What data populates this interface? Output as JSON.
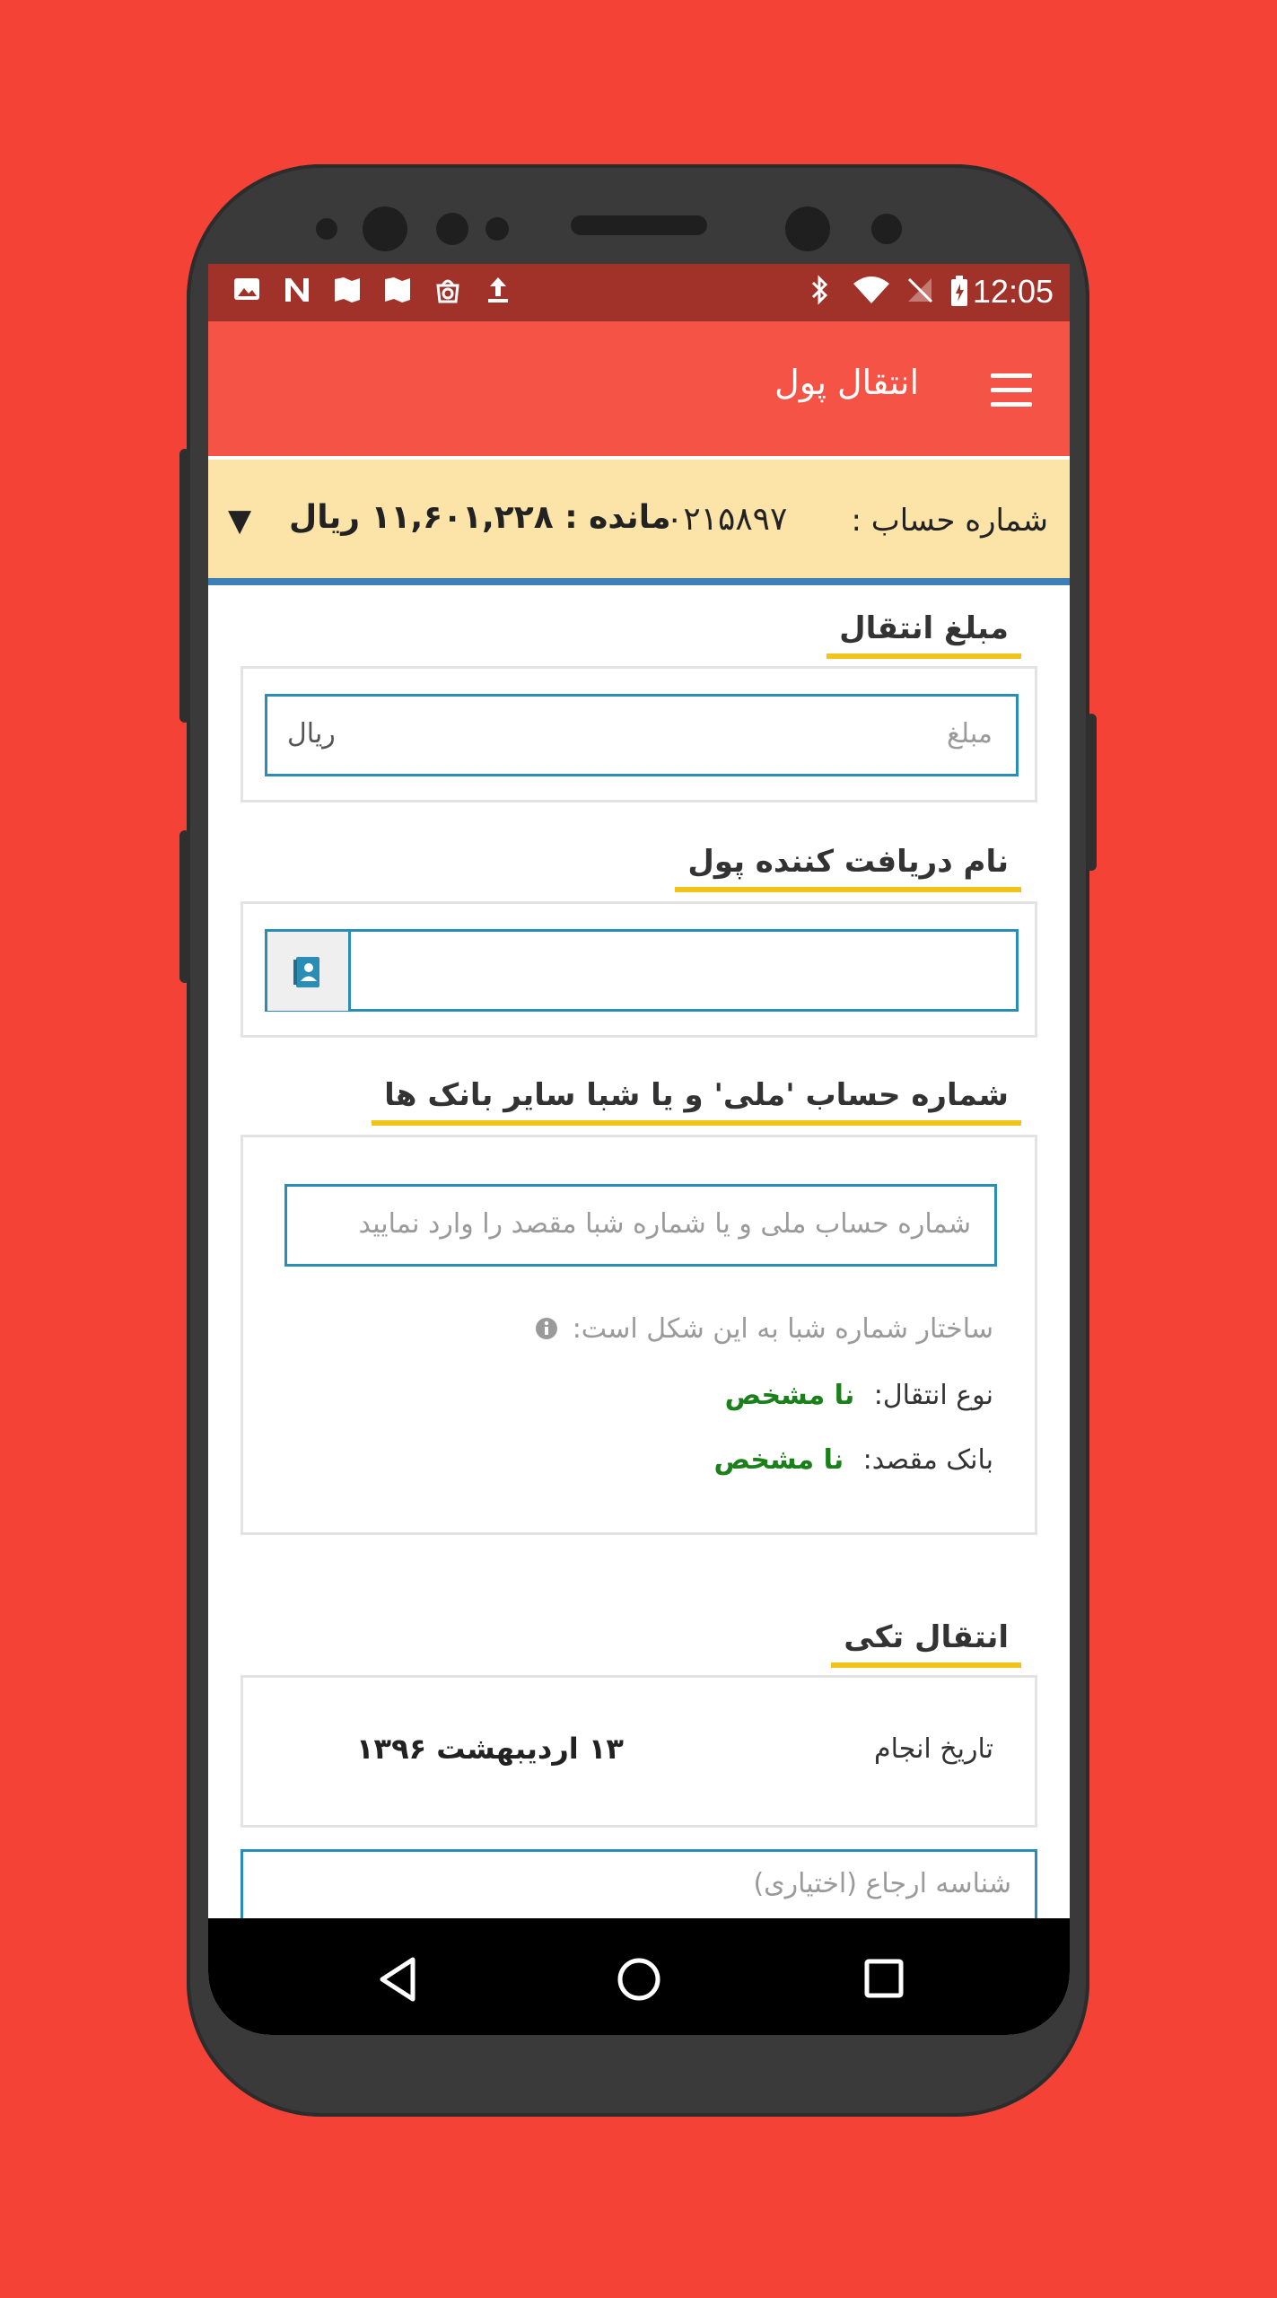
{
  "status_bar": {
    "time": "12:05",
    "left_icons": [
      "image-icon",
      "n-icon",
      "map-icon",
      "map-icon",
      "sync-icon",
      "upload-icon"
    ],
    "right_icons": [
      "bluetooth-icon",
      "wifi-icon",
      "no-signal-icon",
      "battery-icon"
    ]
  },
  "app_bar": {
    "title": "انتقال پول"
  },
  "account": {
    "label": "شماره حساب :",
    "number": "۰۲۱۵۸۹۷",
    "balance": "مانده : ۱۱,۶۰۱,۲۲۸ ریال",
    "dropdown_glyph": "▼"
  },
  "amount_section": {
    "title": "مبلغ انتقال",
    "placeholder": "مبلغ",
    "unit": "ریال"
  },
  "receiver_section": {
    "title": "نام دریافت کننده پول"
  },
  "account_section": {
    "title": "شماره حساب 'ملی' و یا شبا سایر بانک ها",
    "placeholder": "شماره حساب ملی و یا شماره شبا مقصد را وارد نمایید",
    "sheba_hint": "ساختار شماره شبا به این شکل است:",
    "transfer_type_label": "نوع انتقال:",
    "transfer_type_value": "نا مشخص",
    "dest_bank_label": "بانک مقصد:",
    "dest_bank_value": "نا مشخص"
  },
  "single_transfer": {
    "title": "انتقال تکی",
    "date_label": "تاریخ انجام",
    "date_value": "۱۳ اردیبهشت ۱۳۹۶"
  },
  "reference": {
    "placeholder": "شناسه ارجاع (اختیاری)"
  },
  "colors": {
    "background": "#f44336",
    "app_bar": "#f55346",
    "status_bar": "#a1322a",
    "account_bar": "#fce3a8",
    "accent_underline": "#f0c419",
    "input_border": "#2a8db5",
    "value_green": "#1b7f1b"
  }
}
